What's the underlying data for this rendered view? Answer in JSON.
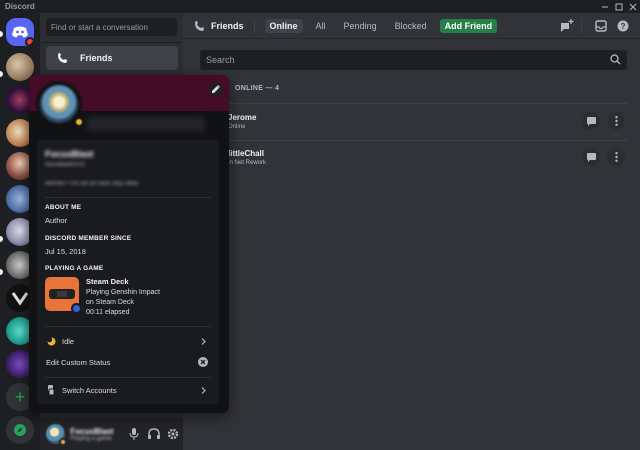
{
  "app": {
    "title": "Discord"
  },
  "sidebar": {
    "search_placeholder": "Find or start a conversation",
    "friends_label": "Friends"
  },
  "user_panel": {
    "name": "FocusBlast",
    "status": "Playing a game"
  },
  "header": {
    "title": "Friends",
    "tabs": {
      "online": "Online",
      "all": "All",
      "pending": "Pending",
      "blocked": "Blocked",
      "add_friend": "Add Friend"
    }
  },
  "search": {
    "placeholder": "Search"
  },
  "friends_list": {
    "count_label": "ONLINE — 4",
    "rows": [
      {
        "name": "Jerome",
        "status": "Online"
      },
      {
        "name": "littleChall",
        "status": "In Net Rework"
      }
    ]
  },
  "profile": {
    "display_name": "FocusBlast",
    "username": "focusblast0101",
    "pronouns": "He/Him • I'm not on here very often",
    "about_me_heading": "ABOUT ME",
    "about_me": "Author",
    "member_since_heading": "DISCORD MEMBER SINCE",
    "member_since": "Jul 15, 2018",
    "playing_heading": "PLAYING A GAME",
    "game": {
      "title": "Steam Deck",
      "line1": "Playing Genshin Impact",
      "line2": "on Steam Deck",
      "elapsed": "00:11 elapsed"
    },
    "menu": {
      "idle": "Idle",
      "custom_status": "Edit Custom Status",
      "switch_accounts": "Switch Accounts"
    }
  },
  "colors": {
    "brand": "#5865f2",
    "add_friend_green": "#248046",
    "idle": "#f0b232",
    "banner": "#450c28",
    "game_tile": "#e8743a"
  }
}
